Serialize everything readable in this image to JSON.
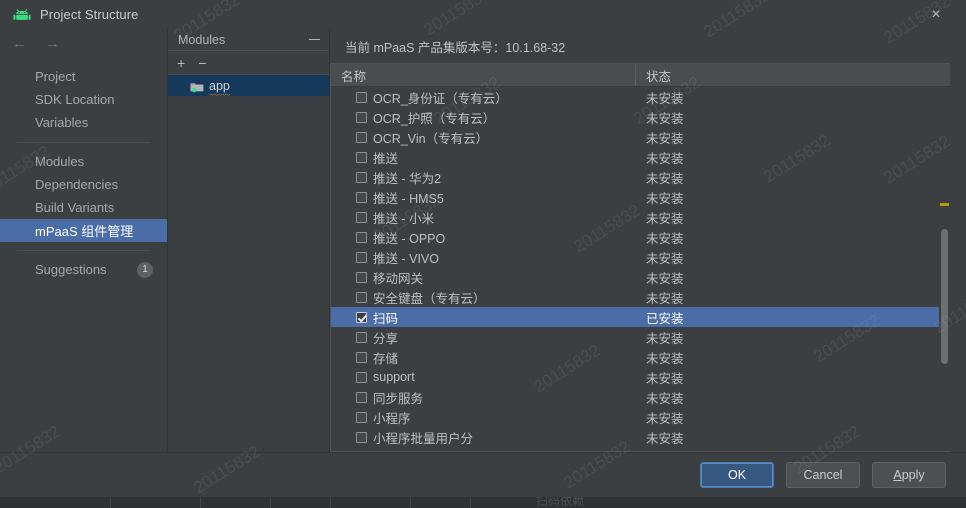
{
  "window": {
    "title": "Project Structure",
    "app_icon": "android-icon",
    "close_label": "×"
  },
  "nav": {
    "back_icon": "←",
    "forward_icon": "→",
    "groups": [
      {
        "items": [
          {
            "label": "Project",
            "selected": false
          },
          {
            "label": "SDK Location",
            "selected": false
          },
          {
            "label": "Variables",
            "selected": false
          }
        ]
      },
      {
        "items": [
          {
            "label": "Modules",
            "selected": false
          },
          {
            "label": "Dependencies",
            "selected": false
          },
          {
            "label": "Build Variants",
            "selected": false
          },
          {
            "label": "mPaaS 组件管理",
            "selected": true
          }
        ]
      },
      {
        "items": [
          {
            "label": "Suggestions",
            "selected": false,
            "badge": "1"
          }
        ]
      }
    ]
  },
  "modules": {
    "header_title": "Modules",
    "collapse_icon": "minimize-icon",
    "add_label": "+",
    "remove_label": "−",
    "tree": [
      {
        "label": "app",
        "selected": true,
        "icon": "module-folder-icon"
      }
    ]
  },
  "main": {
    "version_text": "当前 mPaaS 产品集版本号：10.1.68-32",
    "columns": {
      "name": "名称",
      "status": "状态"
    },
    "status_values": {
      "installed": "已安装",
      "not_installed": "未安装"
    },
    "rows": [
      {
        "name": "OCR_身份证（专有云）",
        "status": "未安装",
        "checked": false,
        "selected": false
      },
      {
        "name": "OCR_护照（专有云）",
        "status": "未安装",
        "checked": false,
        "selected": false
      },
      {
        "name": "OCR_Vin（专有云）",
        "status": "未安装",
        "checked": false,
        "selected": false
      },
      {
        "name": "推送",
        "status": "未安装",
        "checked": false,
        "selected": false
      },
      {
        "name": "推送 - 华为2",
        "status": "未安装",
        "checked": false,
        "selected": false
      },
      {
        "name": "推送 - HMS5",
        "status": "未安装",
        "checked": false,
        "selected": false
      },
      {
        "name": "推送 - 小米",
        "status": "未安装",
        "checked": false,
        "selected": false
      },
      {
        "name": "推送 - OPPO",
        "status": "未安装",
        "checked": false,
        "selected": false
      },
      {
        "name": "推送 - VIVO",
        "status": "未安装",
        "checked": false,
        "selected": false
      },
      {
        "name": "移动网关",
        "status": "未安装",
        "checked": false,
        "selected": false
      },
      {
        "name": "安全键盘（专有云）",
        "status": "未安装",
        "checked": false,
        "selected": false
      },
      {
        "name": "扫码",
        "status": "已安装",
        "checked": true,
        "selected": true
      },
      {
        "name": "分享",
        "status": "未安装",
        "checked": false,
        "selected": false
      },
      {
        "name": "存储",
        "status": "未安装",
        "checked": false,
        "selected": false
      },
      {
        "name": "support",
        "status": "未安装",
        "checked": false,
        "selected": false
      },
      {
        "name": "同步服务",
        "status": "未安装",
        "checked": false,
        "selected": false
      },
      {
        "name": "小程序",
        "status": "未安装",
        "checked": false,
        "selected": false
      },
      {
        "name": "小程序批量用户分",
        "status": "未安装",
        "checked": false,
        "selected": false
      }
    ]
  },
  "footer": {
    "ok": "OK",
    "cancel": "Cancel",
    "apply_prefix": "A",
    "apply_rest": "pply"
  },
  "backdrop": {
    "bottom_text": "扫码依赖"
  },
  "watermark": {
    "text": "20115832"
  },
  "colors": {
    "dialog_bg": "#3c3f41",
    "selection_blue": "#4a6da7",
    "tree_selection": "#15395b",
    "primary_button": "#365880",
    "marker_yellow": "#c2950f",
    "android_green": "#3ddc84"
  }
}
